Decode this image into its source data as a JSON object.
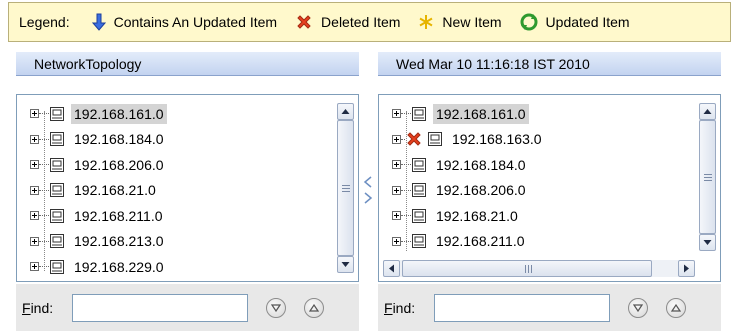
{
  "legend": {
    "label": "Legend:",
    "items": [
      {
        "icon": "blue-down-arrow-icon",
        "text": "Contains An Updated Item",
        "color": "#2a5bd7"
      },
      {
        "icon": "red-x-icon",
        "text": "Deleted Item",
        "color": "#e03a1e"
      },
      {
        "icon": "yellow-asterisk-icon",
        "text": "New Item",
        "color": "#e6b400"
      },
      {
        "icon": "green-refresh-icon",
        "text": "Updated Item",
        "color": "#2f9a2f"
      }
    ]
  },
  "left": {
    "title": "NetworkTopology",
    "nodes": [
      {
        "label": "192.168.161.0",
        "selected": true
      },
      {
        "label": "192.168.184.0"
      },
      {
        "label": "192.168.206.0"
      },
      {
        "label": "192.168.21.0"
      },
      {
        "label": "192.168.211.0"
      },
      {
        "label": "192.168.213.0"
      },
      {
        "label": "192.168.229.0"
      }
    ],
    "find_label_underlined": "F",
    "find_label_rest": "ind:",
    "find_value": ""
  },
  "right": {
    "title": "Wed Mar 10 11:16:18 IST 2010",
    "nodes": [
      {
        "label": "192.168.161.0",
        "selected": true
      },
      {
        "label": "192.168.163.0",
        "deleted": true
      },
      {
        "label": "192.168.184.0"
      },
      {
        "label": "192.168.206.0"
      },
      {
        "label": "192.168.21.0"
      },
      {
        "label": "192.168.211.0"
      }
    ],
    "find_label_underlined": "F",
    "find_label_rest": "ind:",
    "find_value": ""
  },
  "colors": {
    "legend_bg": "#fff9cc",
    "header_bg": "#c3d3f0",
    "selection": "#d4d4d4",
    "findbar_bg": "#e8e8e8"
  }
}
